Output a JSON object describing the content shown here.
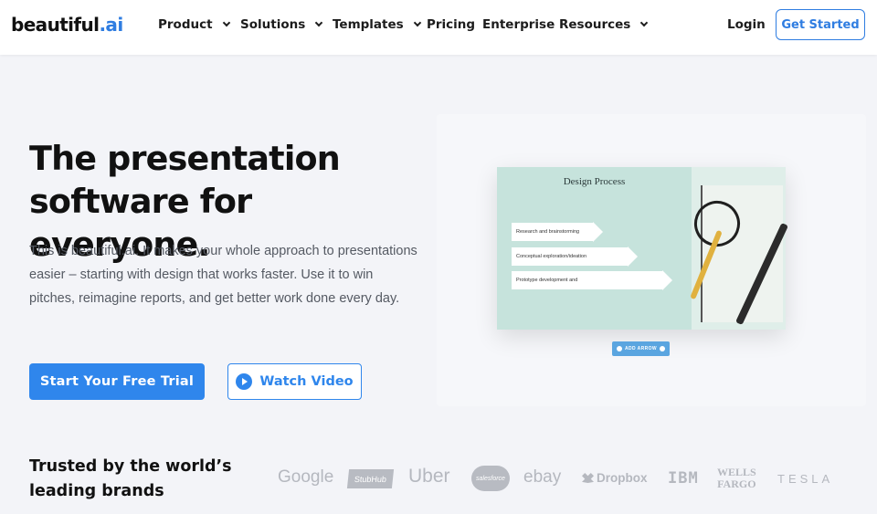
{
  "nav": {
    "logo_text": "beautiful",
    "logo_suffix": ".ai",
    "items": [
      {
        "label": "Product"
      },
      {
        "label": "Solutions"
      },
      {
        "label": "Templates"
      },
      {
        "label": "Pricing"
      },
      {
        "label": "Enterprise"
      },
      {
        "label": "Resources"
      }
    ],
    "login": "Login",
    "get_started": "Get Started"
  },
  "hero": {
    "title_line1": "The presentation",
    "title_line2": "software for everyone.",
    "description": "This is beautiful.ai. It makes your whole approach to presentations easier – starting with design that works faster. Use it to win pitches, reimagine reports, and get better work done every day.",
    "cta_primary": "Start Your Free Trial",
    "cta_secondary": "Watch Video"
  },
  "slide_preview": {
    "title": "Design Process",
    "steps": [
      "Research and brainstorming",
      "Conceptual exploration/ideation",
      "Prototype development and"
    ],
    "add_arrow_label": "ADD ARROW"
  },
  "trusted": {
    "heading_line1": "Trusted by the world’s",
    "heading_line2": "leading brands",
    "brands": {
      "google": "Google",
      "stubhub": "StubHub",
      "uber": "Uber",
      "salesforce": "salesforce",
      "ebay": "ebay",
      "dropbox": "Dropbox",
      "ibm": "IBM",
      "wells_line1": "WELLS",
      "wells_line2": "FARGO",
      "tesla": "TESLA"
    }
  },
  "colors": {
    "accent": "#2f86ec",
    "slide_bg": "#c6e3dc",
    "page_bg": "#f3f4f8"
  }
}
